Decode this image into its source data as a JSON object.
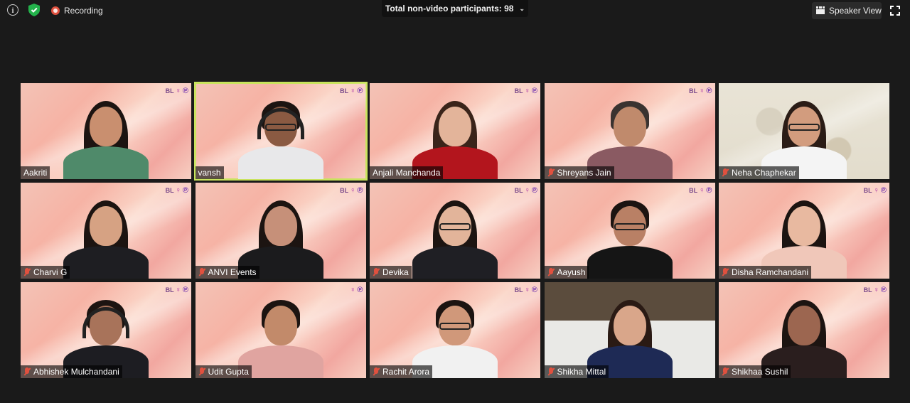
{
  "toolbar": {
    "recording_label": "Recording",
    "participants_label": "Total non-video participants: 98",
    "speaker_view_label": "Speaker View"
  },
  "colors": {
    "active_speaker_border": "#c9e35e",
    "recording_red": "#e0513f",
    "background": "#1a1a1a"
  },
  "tiles": [
    {
      "name": "Aakriti",
      "muted": false
    },
    {
      "name": "vansh",
      "muted": false,
      "active": true
    },
    {
      "name": "Anjali Manchanda",
      "muted": false
    },
    {
      "name": "Shreyans Jain",
      "muted": true
    },
    {
      "name": "Neha Chaphekar",
      "muted": true
    },
    {
      "name": "Charvi G",
      "muted": true
    },
    {
      "name": "ANVI Events",
      "muted": true
    },
    {
      "name": "Devika",
      "muted": true
    },
    {
      "name": "Aayush",
      "muted": true
    },
    {
      "name": "Disha Ramchandani",
      "muted": true
    },
    {
      "name": "Abhishek Mulchandani",
      "muted": true
    },
    {
      "name": "Udit Gupta",
      "muted": true
    },
    {
      "name": "Rachit Arora",
      "muted": true
    },
    {
      "name": "Shikha Mittal",
      "muted": true
    },
    {
      "name": "Shikhaa Sushil",
      "muted": true
    }
  ]
}
